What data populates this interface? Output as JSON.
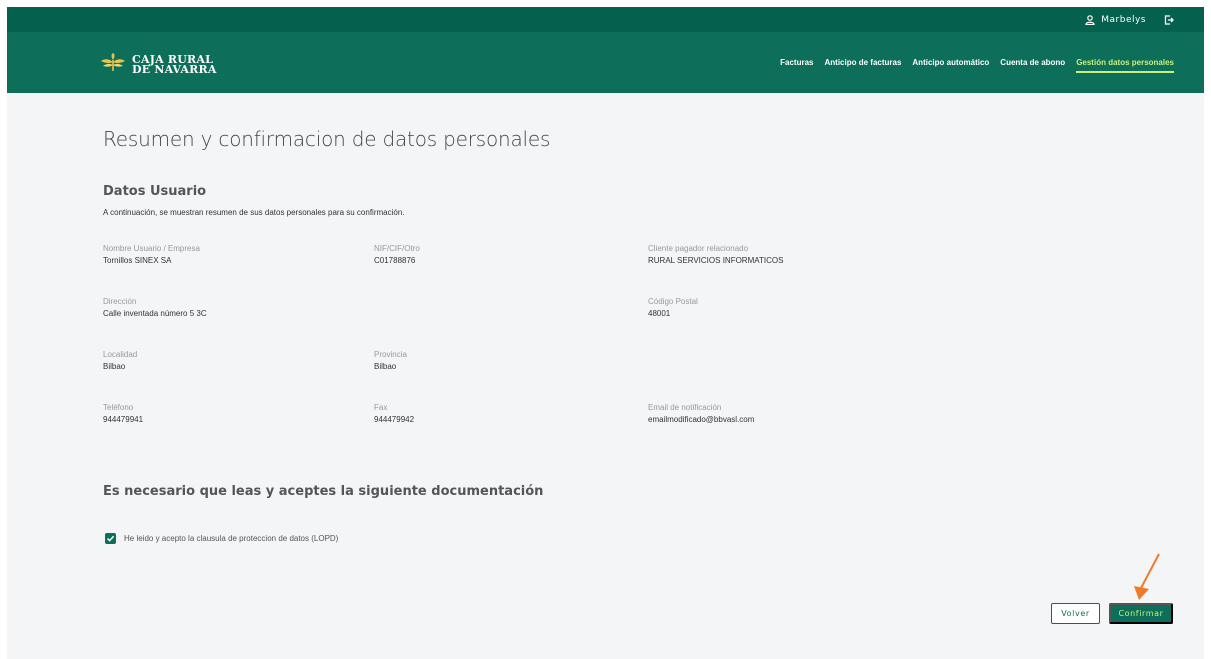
{
  "topbar": {
    "user_name": "Marbelys"
  },
  "brand": {
    "line1": "CAJA RURAL",
    "line2": "DE NAVARRA"
  },
  "nav": {
    "items": [
      {
        "label": "Facturas"
      },
      {
        "label": "Anticipo de facturas"
      },
      {
        "label": "Anticipo automático"
      },
      {
        "label": "Cuenta de abono"
      },
      {
        "label": "Gestión datos personales"
      }
    ]
  },
  "page": {
    "title": "Resumen y confirmacion de datos personales",
    "section_title": "Datos Usuario",
    "section_desc": "A continuación, se muestran resumen de sus datos personales para su confirmación."
  },
  "fields": {
    "nombre": {
      "label": "Nombre Usuario / Empresa",
      "value": "Tornillos SINEX SA"
    },
    "nif": {
      "label": "NIF/CIF/Otro",
      "value": "C01788876"
    },
    "cliente": {
      "label": "Cliente pagador relacionado",
      "value": "RURAL SERVICIOS INFORMATICOS"
    },
    "direccion": {
      "label": "Dirección",
      "value": "Calle inventada número 5 3C"
    },
    "cp": {
      "label": "Código Postal",
      "value": "48001"
    },
    "localidad": {
      "label": "Localidad",
      "value": "Bilbao"
    },
    "provincia": {
      "label": "Provincia",
      "value": "Bilbao"
    },
    "telefono": {
      "label": "Teléfono",
      "value": "944479941"
    },
    "fax": {
      "label": "Fax",
      "value": "944479942"
    },
    "email": {
      "label": "Email de notificación",
      "value": "emailmodificado@bbvasl.com"
    }
  },
  "documentation": {
    "title": "Es necesario que leas y aceptes la siguiente documentación",
    "checkbox_label": "He leido y acepto la clausula de proteccion de datos (LOPD)",
    "checked": true
  },
  "actions": {
    "back_label": "Volver",
    "confirm_label": "Confirmar"
  },
  "colors": {
    "primary": "#0d6e5a",
    "topbar": "#05614d",
    "accent": "#c8f07c",
    "arrow": "#f07a28"
  },
  "icons": {
    "user": "user-icon",
    "logout": "logout-icon",
    "logo": "wheat-logo-icon",
    "check": "check-icon",
    "pointer": "arrow-pointer-icon"
  }
}
